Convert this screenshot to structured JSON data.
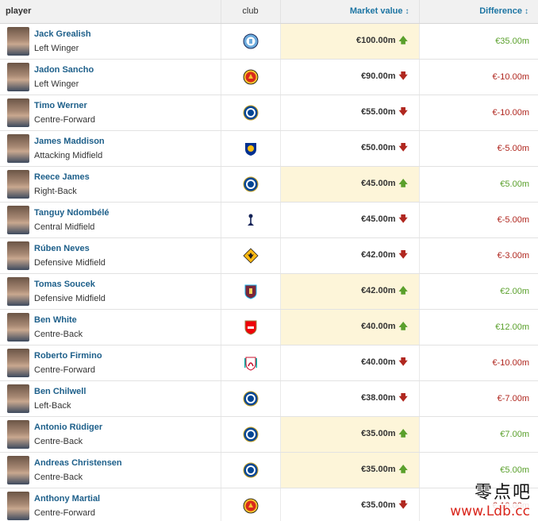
{
  "header": {
    "player": "player",
    "club": "club",
    "market_value": "Market value",
    "difference": "Difference",
    "sort_icon": "↕"
  },
  "colors": {
    "up": "#5aa02c",
    "down": "#b0271f",
    "highlight": "#fdf5d9",
    "link": "#1d5f8a"
  },
  "rows": [
    {
      "name": "Jack Grealish",
      "position": "Left Winger",
      "club_icon": "man-city-crest",
      "value": "€100.00m",
      "trend": "up",
      "trend_glyph": "🡅",
      "difference": "€35.00m"
    },
    {
      "name": "Jadon Sancho",
      "position": "Left Winger",
      "club_icon": "man-united-crest",
      "value": "€90.00m",
      "trend": "down",
      "trend_glyph": "🡇",
      "difference": "€-10.00m"
    },
    {
      "name": "Timo Werner",
      "position": "Centre-Forward",
      "club_icon": "chelsea-crest",
      "value": "€55.00m",
      "trend": "down",
      "trend_glyph": "🡇",
      "difference": "€-10.00m"
    },
    {
      "name": "James Maddison",
      "position": "Attacking Midfield",
      "club_icon": "leicester-crest",
      "value": "€50.00m",
      "trend": "down",
      "trend_glyph": "🡇",
      "difference": "€-5.00m"
    },
    {
      "name": "Reece James",
      "position": "Right-Back",
      "club_icon": "chelsea-crest",
      "value": "€45.00m",
      "trend": "up",
      "trend_glyph": "🡅",
      "difference": "€5.00m"
    },
    {
      "name": "Tanguy Ndombélé",
      "position": "Central Midfield",
      "club_icon": "tottenham-crest",
      "value": "€45.00m",
      "trend": "down",
      "trend_glyph": "🡇",
      "difference": "€-5.00m"
    },
    {
      "name": "Rúben Neves",
      "position": "Defensive Midfield",
      "club_icon": "wolves-crest",
      "value": "€42.00m",
      "trend": "down",
      "trend_glyph": "🡇",
      "difference": "€-3.00m"
    },
    {
      "name": "Tomas Soucek",
      "position": "Defensive Midfield",
      "club_icon": "west-ham-crest",
      "value": "€42.00m",
      "trend": "up",
      "trend_glyph": "🡅",
      "difference": "€2.00m"
    },
    {
      "name": "Ben White",
      "position": "Centre-Back",
      "club_icon": "arsenal-crest",
      "value": "€40.00m",
      "trend": "up",
      "trend_glyph": "🡅",
      "difference": "€12.00m"
    },
    {
      "name": "Roberto Firmino",
      "position": "Centre-Forward",
      "club_icon": "liverpool-crest",
      "value": "€40.00m",
      "trend": "down",
      "trend_glyph": "🡇",
      "difference": "€-10.00m"
    },
    {
      "name": "Ben Chilwell",
      "position": "Left-Back",
      "club_icon": "chelsea-crest",
      "value": "€38.00m",
      "trend": "down",
      "trend_glyph": "🡇",
      "difference": "€-7.00m"
    },
    {
      "name": "Antonio Rüdiger",
      "position": "Centre-Back",
      "club_icon": "chelsea-crest",
      "value": "€35.00m",
      "trend": "up",
      "trend_glyph": "🡅",
      "difference": "€7.00m"
    },
    {
      "name": "Andreas Christensen",
      "position": "Centre-Back",
      "club_icon": "chelsea-crest",
      "value": "€35.00m",
      "trend": "up",
      "trend_glyph": "🡅",
      "difference": "€5.00m"
    },
    {
      "name": "Anthony Martial",
      "position": "Centre-Forward",
      "club_icon": "man-united-crest",
      "value": "€35.00m",
      "trend": "down",
      "trend_glyph": "🡇",
      "difference": "€-10.00m"
    }
  ],
  "watermark": {
    "text_cn": "零点吧",
    "url": "www.Ldb.cc"
  }
}
